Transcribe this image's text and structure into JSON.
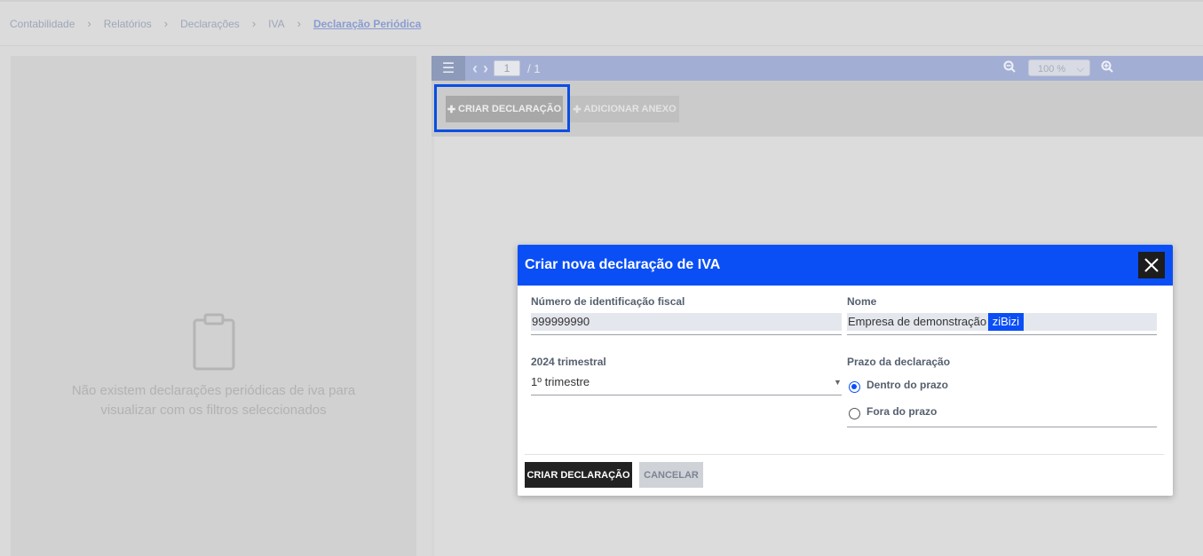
{
  "breadcrumb": {
    "items": [
      "Contabilidade",
      "Relatórios",
      "Declarações",
      "IVA"
    ],
    "current": "Declaração Periódica"
  },
  "left_panel": {
    "empty_line1": "Não existem declarações periódicas de iva para",
    "empty_line2": "visualizar com os filtros seleccionados",
    "icon": "clipboard-icon"
  },
  "viewer": {
    "page_current": "1",
    "page_total": "/ 1",
    "zoom": "100 %",
    "create_button": "CRIAR DECLARAÇÃO",
    "add_anexo_button": "ADICIONAR ANEXO"
  },
  "modal": {
    "title": "Criar nova declaração de IVA",
    "nif_label": "Número de identificação fiscal",
    "nif_value": "999999990",
    "nome_label": "Nome",
    "nome_value": "Empresa de demonstração",
    "nome_selected": "ziBizi",
    "periodo_label": "2024 trimestral",
    "periodo_value": "1º trimestre",
    "prazo_label": "Prazo da declaração",
    "prazo_options": [
      "Dentro do prazo",
      "Fora do prazo"
    ],
    "prazo_selected": "Dentro do prazo",
    "submit_button": "CRIAR DECLARAÇÃO",
    "cancel_button": "CANCELAR"
  },
  "colors": {
    "accent": "#0a4ef6",
    "highlight_border": "#0a4ee3",
    "toolbar": "#a3aed4"
  }
}
